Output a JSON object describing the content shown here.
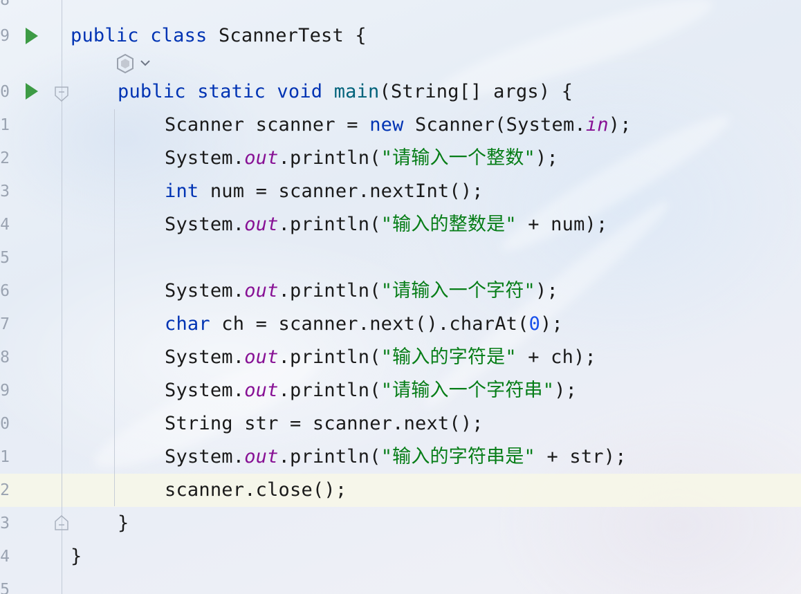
{
  "editor": {
    "lines": [
      {
        "number": "8",
        "text": ""
      },
      {
        "number": "9",
        "tokens": [
          {
            "t": "public ",
            "c": "kw"
          },
          {
            "t": "class ",
            "c": "kw"
          },
          {
            "t": "ScannerTest {",
            "c": "plain"
          }
        ]
      },
      {
        "number": "0",
        "tokens": [
          {
            "t": "public ",
            "c": "kw"
          },
          {
            "t": "static ",
            "c": "kw"
          },
          {
            "t": "void ",
            "c": "kw"
          },
          {
            "t": "main",
            "c": "fn"
          },
          {
            "t": "(String[] args) {",
            "c": "plain"
          }
        ]
      },
      {
        "number": "1",
        "tokens": [
          {
            "t": "Scanner scanner = ",
            "c": "plain"
          },
          {
            "t": "new ",
            "c": "kw"
          },
          {
            "t": "Scanner(System.",
            "c": "plain"
          },
          {
            "t": "in",
            "c": "field"
          },
          {
            "t": ");",
            "c": "plain"
          }
        ]
      },
      {
        "number": "2",
        "tokens": [
          {
            "t": "System.",
            "c": "plain"
          },
          {
            "t": "out",
            "c": "field"
          },
          {
            "t": ".println(",
            "c": "plain"
          },
          {
            "t": "\"请输入一个整数\"",
            "c": "str"
          },
          {
            "t": ");",
            "c": "plain"
          }
        ]
      },
      {
        "number": "3",
        "tokens": [
          {
            "t": "int ",
            "c": "kw"
          },
          {
            "t": "num = scanner.nextInt();",
            "c": "plain"
          }
        ]
      },
      {
        "number": "4",
        "tokens": [
          {
            "t": "System.",
            "c": "plain"
          },
          {
            "t": "out",
            "c": "field"
          },
          {
            "t": ".println(",
            "c": "plain"
          },
          {
            "t": "\"输入的整数是\"",
            "c": "str"
          },
          {
            "t": " + num);",
            "c": "plain"
          }
        ]
      },
      {
        "number": "5",
        "tokens": []
      },
      {
        "number": "6",
        "tokens": [
          {
            "t": "System.",
            "c": "plain"
          },
          {
            "t": "out",
            "c": "field"
          },
          {
            "t": ".println(",
            "c": "plain"
          },
          {
            "t": "\"请输入一个字符\"",
            "c": "str"
          },
          {
            "t": ");",
            "c": "plain"
          }
        ]
      },
      {
        "number": "7",
        "tokens": [
          {
            "t": "char ",
            "c": "kw"
          },
          {
            "t": "ch = scanner.next().charAt(",
            "c": "plain"
          },
          {
            "t": "0",
            "c": "num"
          },
          {
            "t": ");",
            "c": "plain"
          }
        ]
      },
      {
        "number": "8",
        "tokens": [
          {
            "t": "System.",
            "c": "plain"
          },
          {
            "t": "out",
            "c": "field"
          },
          {
            "t": ".println(",
            "c": "plain"
          },
          {
            "t": "\"输入的字符是\"",
            "c": "str"
          },
          {
            "t": " + ch);",
            "c": "plain"
          }
        ]
      },
      {
        "number": "9",
        "tokens": [
          {
            "t": "System.",
            "c": "plain"
          },
          {
            "t": "out",
            "c": "field"
          },
          {
            "t": ".println(",
            "c": "plain"
          },
          {
            "t": "\"请输入一个字符串\"",
            "c": "str"
          },
          {
            "t": ");",
            "c": "plain"
          }
        ]
      },
      {
        "number": "0",
        "tokens": [
          {
            "t": "String str = scanner.next();",
            "c": "plain"
          }
        ]
      },
      {
        "number": "1",
        "tokens": [
          {
            "t": "System.",
            "c": "plain"
          },
          {
            "t": "out",
            "c": "field"
          },
          {
            "t": ".println(",
            "c": "plain"
          },
          {
            "t": "\"输入的字符串是\"",
            "c": "str"
          },
          {
            "t": " + str);",
            "c": "plain"
          }
        ]
      },
      {
        "number": "2",
        "tokens": [
          {
            "t": "scanner.close();",
            "c": "plain"
          }
        ]
      },
      {
        "number": "3",
        "tokens": [
          {
            "t": "}",
            "c": "plain"
          }
        ]
      },
      {
        "number": "4",
        "tokens": [
          {
            "t": "}",
            "c": "plain"
          }
        ]
      },
      {
        "number": "5",
        "tokens": []
      }
    ],
    "icons": {
      "run_class": "run-icon",
      "run_main": "run-icon",
      "fold_open": "fold-open-icon",
      "fold_close": "fold-close-icon",
      "ai_hint": "ai-assistant-icon"
    },
    "colors": {
      "keyword": "#0033b3",
      "method": "#00627a",
      "static_field": "#871094",
      "string": "#067d17",
      "number": "#1750eb",
      "run": "#3d9b45"
    }
  }
}
